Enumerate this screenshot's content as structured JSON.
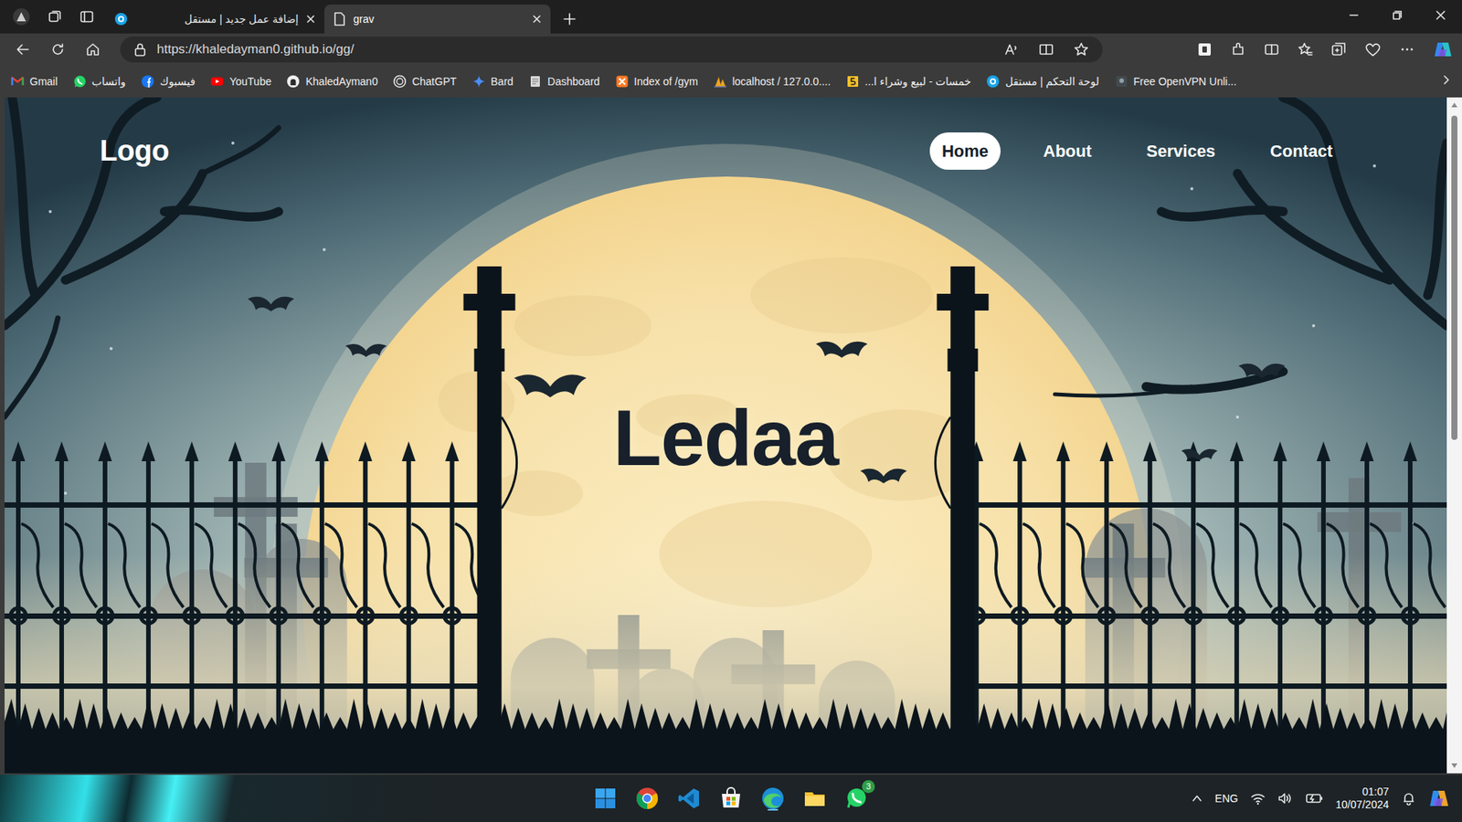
{
  "browser": {
    "tabs": [
      {
        "label": "إضافة عمل جديد | مستقل",
        "selected": false
      },
      {
        "label": "grav",
        "selected": true
      }
    ],
    "address": "https://khaledayman0.github.io/gg/",
    "bookmarks": [
      {
        "label": "Gmail",
        "kind": "gmail"
      },
      {
        "label": "واتساب",
        "kind": "whatsapp"
      },
      {
        "label": "فيسبوك",
        "kind": "facebook"
      },
      {
        "label": "YouTube",
        "kind": "youtube"
      },
      {
        "label": "KhaledAyman0",
        "kind": "github"
      },
      {
        "label": "ChatGPT",
        "kind": "chatgpt"
      },
      {
        "label": "Bard",
        "kind": "bard"
      },
      {
        "label": "Dashboard",
        "kind": "dashboard"
      },
      {
        "label": "Index of /gym",
        "kind": "xampp"
      },
      {
        "label": "localhost / 127.0.0....",
        "kind": "phpmyadmin"
      },
      {
        "label": "خمسات - لبيع وشراء ا...",
        "kind": "khamsat"
      },
      {
        "label": "لوحة التحكم | مستقل",
        "kind": "mostaql"
      },
      {
        "label": "Free OpenVPN Unli...",
        "kind": "openvpn"
      }
    ]
  },
  "page": {
    "logo": "Logo",
    "nav": [
      {
        "label": "Home",
        "selected": true
      },
      {
        "label": "About",
        "selected": false
      },
      {
        "label": "Services",
        "selected": false
      },
      {
        "label": "Contact",
        "selected": false
      }
    ],
    "hero_title": "Ledaa"
  },
  "taskbar": {
    "whatsapp_badge": "3",
    "language": "ENG",
    "time": "01:07",
    "date": "10/07/2024"
  }
}
